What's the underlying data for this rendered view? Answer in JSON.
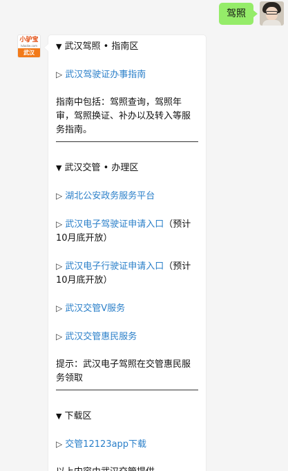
{
  "outgoing": {
    "text": "驾照"
  },
  "incoming": {
    "avatar": {
      "logo_text": "小驴宝",
      "logo_sub": "lvbaike.com",
      "city": "武汉"
    },
    "sections": [
      {
        "title": "武汉驾照 • 指南区",
        "links": [
          {
            "text": "武汉驾驶证办事指南",
            "note": ""
          }
        ],
        "description": "指南中包括：驾照查询，驾照年审，驾照换证、补办以及转入等服务指南。"
      },
      {
        "title": "武汉交管 • 办理区",
        "links": [
          {
            "text": "湖北公安政务服务平台",
            "note": ""
          },
          {
            "text": "武汉电子驾驶证申请入口",
            "note": "（预计10月底开放）"
          },
          {
            "text": "武汉电子行驶证申请入口",
            "note": "（预计10月底开放）"
          },
          {
            "text": "武汉交管V服务",
            "note": ""
          },
          {
            "text": "武汉交管惠民服务",
            "note": ""
          }
        ],
        "description": "提示：武汉电子驾照在交管惠民服务领取"
      },
      {
        "title": "下载区",
        "links": [
          {
            "text": "交管12123app下载",
            "note": ""
          }
        ],
        "description": "以上内容由武汉交管提供"
      }
    ],
    "triangle_glyph": "▼",
    "arrow_glyph": "▷"
  },
  "colors": {
    "link": "#2a7fc9",
    "outgoing_bubble": "#95ec69",
    "background": "#f5f5f5"
  }
}
